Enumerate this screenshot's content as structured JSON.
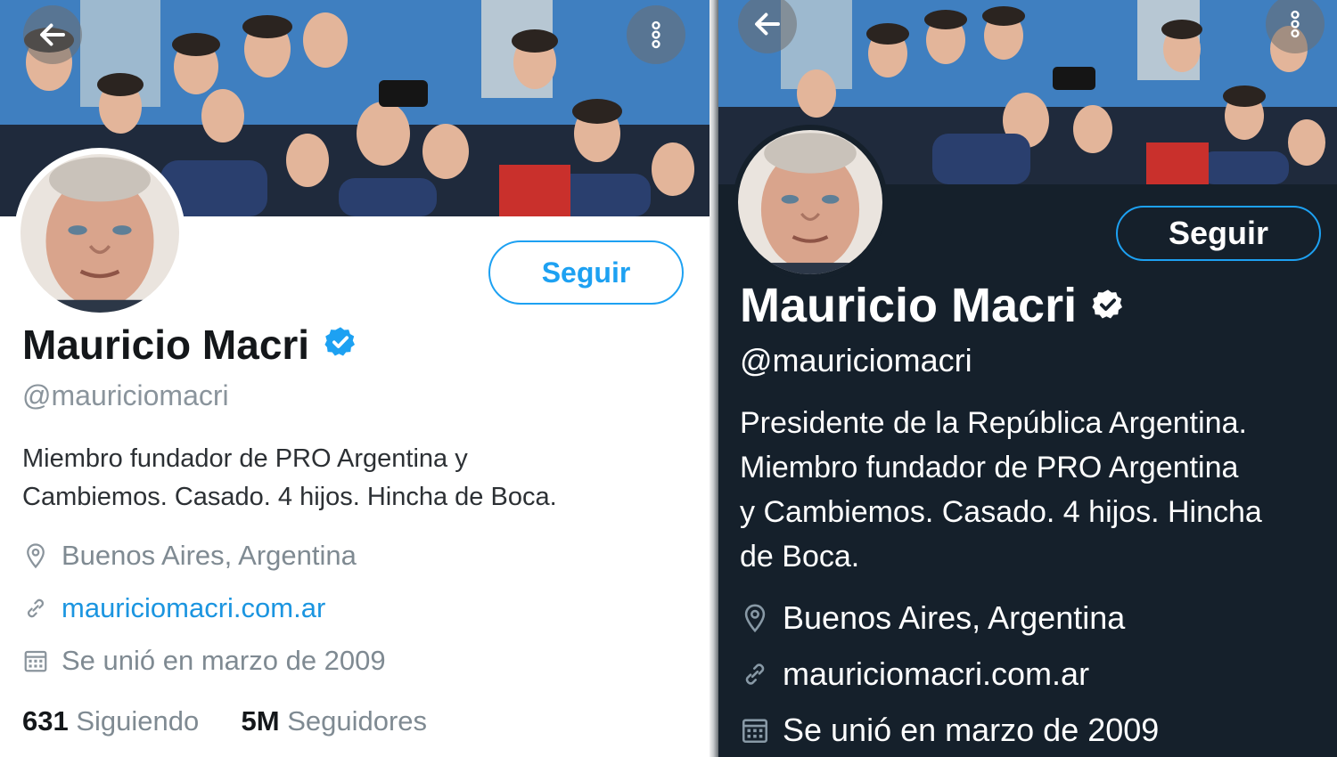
{
  "light": {
    "follow_label": "Seguir",
    "name": "Mauricio Macri",
    "handle": "@mauriciomacri",
    "bio_line1": "Miembro fundador de PRO Argentina y",
    "bio_line2": "Cambiemos. Casado. 4 hijos. Hincha de Boca.",
    "location": "Buenos Aires, Argentina",
    "website": "mauriciomacri.com.ar",
    "joined": "Se unió en marzo de 2009",
    "following_count": "631",
    "following_label": "Siguiendo",
    "followers_count": "5M",
    "followers_label": "Seguidores"
  },
  "dark": {
    "follow_label": "Seguir",
    "name": "Mauricio Macri",
    "handle": "@mauriciomacri",
    "bio_line1": "Presidente de la República Argentina.",
    "bio_line2": "Miembro fundador de PRO Argentina",
    "bio_line3": "y Cambiemos. Casado. 4 hijos. Hincha",
    "bio_line4": "de Boca.",
    "location": "Buenos Aires, Argentina",
    "website": "mauriciomacri.com.ar",
    "joined": "Se unió en marzo de 2009"
  },
  "icons": {
    "back": "arrow-left-icon",
    "more": "more-vertical-icon",
    "verified": "verified-badge-icon",
    "location": "location-pin-icon",
    "link": "link-icon",
    "calendar": "calendar-icon"
  },
  "colors": {
    "accent": "#1da1f2",
    "dark_bg": "#15202b",
    "light_bg": "#ffffff",
    "muted_text": "#7f8a92"
  }
}
